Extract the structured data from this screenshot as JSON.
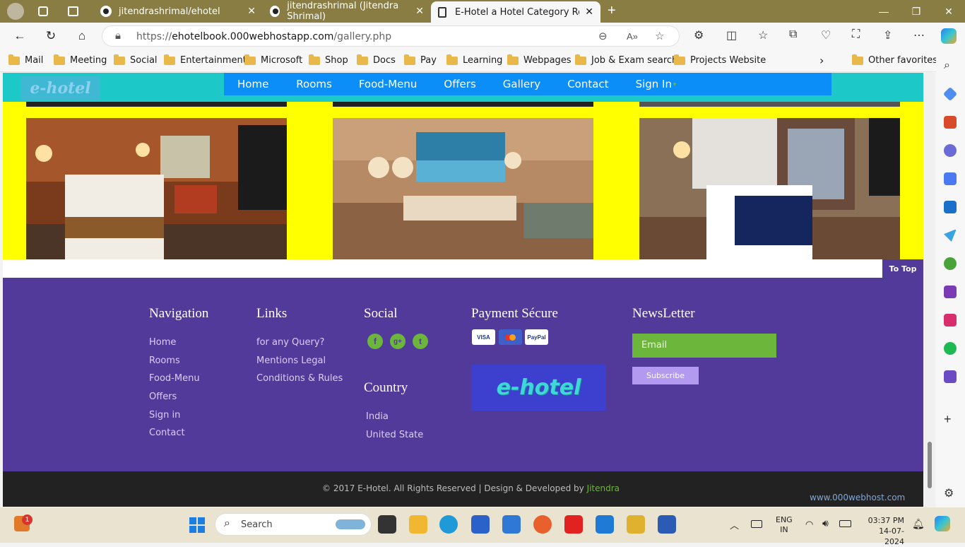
{
  "browser": {
    "tabs": [
      {
        "label": "jitendrashrimal/ehotel"
      },
      {
        "label": "jitendrashrimal (Jitendra Shrimal)"
      },
      {
        "label": "E-Hotel a Hotel Category Respon"
      }
    ],
    "url_prefix": "https://",
    "url_host": "ehotelbook.000webhostapp.com",
    "url_path": "/gallery.php",
    "favorites": [
      "Mail",
      "Meeting",
      "Social",
      "Entertainment",
      "Microsoft",
      "Shop",
      "Docs",
      "Pay",
      "Learning",
      "Webpages",
      "Job & Exam search",
      "Projects Website"
    ],
    "other_favorites": "Other favorites"
  },
  "site": {
    "logo_text": "e-hotel",
    "menu": [
      "Home",
      "Rooms",
      "Food-Menu",
      "Offers",
      "Gallery",
      "Contact",
      "Sign In"
    ],
    "to_top": "To Top",
    "footer": {
      "nav_heading": "Navigation",
      "nav_items": [
        "Home",
        "Rooms",
        "Food-Menu",
        "Offers",
        "Sign in",
        "Contact"
      ],
      "links_heading": "Links",
      "links_items": [
        "for any Query?",
        "Mentions Legal",
        "Conditions & Rules"
      ],
      "social_heading": "Social",
      "country_heading": "Country",
      "country_items": [
        "India",
        "United State"
      ],
      "payment_heading": "Payment Sécure",
      "payment_cards": [
        "VISA",
        "MC",
        "PayPal"
      ],
      "footer_logo": "e-hotel",
      "newsletter_heading": "NewsLetter",
      "email_placeholder": "Email",
      "subscribe": "Subscribe"
    },
    "copyright": "© 2017 E-Hotel. All Rights Reserved | Design & Developed by",
    "author": "Jitendra",
    "host_badge": "www.000webhost.com"
  },
  "taskbar": {
    "search": "Search",
    "lang": "ENG",
    "region": "IN",
    "time": "03:37 PM",
    "date": "14-07-2024",
    "notif_count": "1"
  }
}
